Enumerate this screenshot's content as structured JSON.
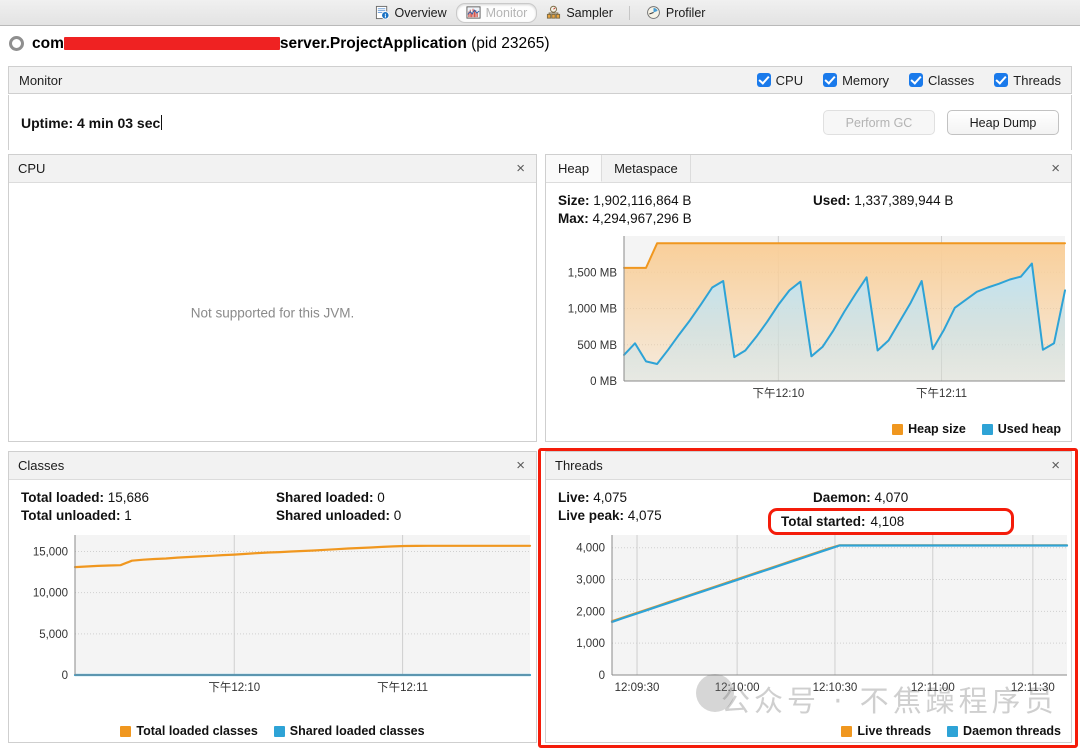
{
  "tabs": [
    {
      "label": "Overview",
      "icon": "overview-icon",
      "selected": false
    },
    {
      "label": "Monitor",
      "icon": "monitor-icon",
      "selected": true
    },
    {
      "label": "Sampler",
      "icon": "sampler-icon",
      "selected": false
    },
    {
      "label": "Profiler",
      "icon": "profiler-icon",
      "selected": false
    }
  ],
  "app": {
    "status_icon": "ring-icon",
    "name_prefix": "com",
    "name_redacted": "█████████████████",
    "name_suffix": "server.ProjectApplication",
    "pid_text": "(pid 23265)"
  },
  "monitor_bar": {
    "title": "Monitor",
    "checkboxes": [
      {
        "label": "CPU",
        "checked": true
      },
      {
        "label": "Memory",
        "checked": true
      },
      {
        "label": "Classes",
        "checked": true
      },
      {
        "label": "Threads",
        "checked": true
      }
    ]
  },
  "uptime": {
    "label": "Uptime: 4 min 03 sec"
  },
  "actions": {
    "perform_gc": "Perform GC",
    "perform_gc_enabled": false,
    "heap_dump": "Heap Dump",
    "heap_dump_enabled": true
  },
  "cpu_panel": {
    "title": "CPU",
    "close": "×",
    "message": "Not supported for this JVM."
  },
  "heap_panel": {
    "tabs": [
      {
        "label": "Heap",
        "selected": true
      },
      {
        "label": "Metaspace",
        "selected": false
      }
    ],
    "close": "×",
    "stats": [
      {
        "label": "Size:",
        "value": "1,902,116,864 B"
      },
      {
        "label": "Used:",
        "value": "1,337,389,944 B"
      },
      {
        "label": "Max:",
        "value": "4,294,967,296 B"
      }
    ],
    "legend": [
      {
        "label": "Heap size",
        "color": "#f0971f"
      },
      {
        "label": "Used heap",
        "color": "#2ea3d6"
      }
    ]
  },
  "classes_panel": {
    "title": "Classes",
    "close": "×",
    "stats": [
      {
        "label": "Total loaded:",
        "value": "15,686"
      },
      {
        "label": "Shared loaded:",
        "value": "0"
      },
      {
        "label": "Total unloaded:",
        "value": "1"
      },
      {
        "label": "Shared unloaded:",
        "value": "0"
      }
    ],
    "legend": [
      {
        "label": "Total loaded classes",
        "color": "#f0971f"
      },
      {
        "label": "Shared loaded classes",
        "color": "#2ea3d6"
      }
    ]
  },
  "threads_panel": {
    "title": "Threads",
    "close": "×",
    "stats": [
      {
        "label": "Live:",
        "value": "4,075"
      },
      {
        "label": "Daemon:",
        "value": "4,070"
      },
      {
        "label": "Live peak:",
        "value": "4,075"
      }
    ],
    "highlighted_stat": {
      "label": "Total started:",
      "value": "4,108"
    },
    "legend": [
      {
        "label": "Live threads",
        "color": "#f0971f"
      },
      {
        "label": "Daemon threads",
        "color": "#2ea3d6"
      }
    ]
  },
  "watermark": {
    "text": "公众号 ·  不焦躁程序员"
  },
  "chart_data": [
    {
      "id": "heap-chart",
      "type": "area",
      "title": "Heap",
      "xlabel": "",
      "ylabel": "",
      "ylim": [
        0,
        2000
      ],
      "yticks": [
        0,
        500,
        1000,
        1500
      ],
      "ytick_labels": [
        "0 MB",
        "500 MB",
        "1,000 MB",
        "1,500 MB"
      ],
      "xtick_labels": [
        "下午12:10",
        "下午12:11"
      ],
      "xtick_positions": [
        0.35,
        0.72
      ],
      "grid": true,
      "legend_position": "bottom",
      "series": [
        {
          "name": "Heap size",
          "color": "#f0971f",
          "fill": "#f9cf9a",
          "values": [
            1560,
            1560,
            1560,
            1900,
            1900,
            1900,
            1900,
            1900,
            1900,
            1900,
            1900,
            1900,
            1900,
            1900,
            1900,
            1900,
            1900,
            1900,
            1900,
            1900,
            1900,
            1900,
            1900,
            1900,
            1900,
            1900,
            1900,
            1900,
            1900,
            1900,
            1900,
            1900,
            1900,
            1900,
            1900,
            1900,
            1900,
            1900,
            1900,
            1900,
            1900
          ]
        },
        {
          "name": "Used heap",
          "color": "#2ea3d6",
          "fill": "#bfe4f5",
          "values": [
            360,
            520,
            270,
            235,
            430,
            640,
            840,
            1060,
            1290,
            1380,
            330,
            420,
            610,
            820,
            1050,
            1250,
            1370,
            340,
            470,
            700,
            960,
            1200,
            1430,
            420,
            560,
            820,
            1080,
            1380,
            440,
            700,
            1010,
            1120,
            1230,
            1290,
            1340,
            1400,
            1440,
            1620,
            430,
            520,
            1250
          ]
        }
      ]
    },
    {
      "id": "classes-chart",
      "type": "line",
      "title": "Classes",
      "ylim": [
        0,
        17000
      ],
      "yticks": [
        0,
        5000,
        10000,
        15000
      ],
      "ytick_labels": [
        "0",
        "5,000",
        "10,000",
        "15,000"
      ],
      "xtick_labels": [
        "下午12:10",
        "下午12:11"
      ],
      "xtick_positions": [
        0.35,
        0.72
      ],
      "grid": true,
      "legend_position": "bottom",
      "series": [
        {
          "name": "Total loaded classes",
          "color": "#f0971f",
          "values": [
            13100,
            13180,
            13250,
            13300,
            13330,
            13880,
            14000,
            14080,
            14150,
            14250,
            14330,
            14400,
            14480,
            14560,
            14620,
            14700,
            14800,
            14870,
            14920,
            15000,
            15060,
            15120,
            15200,
            15280,
            15360,
            15420,
            15480,
            15550,
            15620,
            15660,
            15680,
            15686,
            15686,
            15686,
            15686,
            15686,
            15686,
            15686,
            15686,
            15686,
            15686
          ]
        },
        {
          "name": "Shared loaded classes",
          "color": "#2ea3d6",
          "values": [
            0,
            0,
            0,
            0,
            0,
            0,
            0,
            0,
            0,
            0,
            0,
            0,
            0,
            0,
            0,
            0,
            0,
            0,
            0,
            0,
            0,
            0,
            0,
            0,
            0,
            0,
            0,
            0,
            0,
            0,
            0,
            0,
            0,
            0,
            0,
            0,
            0,
            0,
            0,
            0,
            0
          ]
        }
      ]
    },
    {
      "id": "threads-chart",
      "type": "line",
      "title": "Threads",
      "ylim": [
        0,
        4400
      ],
      "yticks": [
        0,
        1000,
        2000,
        3000,
        4000
      ],
      "ytick_labels": [
        "0",
        "1,000",
        "2,000",
        "3,000",
        "4,000"
      ],
      "xtick_labels": [
        "12:09:30",
        "12:10:00",
        "12:10:30",
        "12:11:00",
        "12:11:30"
      ],
      "xtick_positions": [
        0.055,
        0.275,
        0.49,
        0.705,
        0.925
      ],
      "grid": true,
      "legend_position": "bottom",
      "series": [
        {
          "name": "Live threads",
          "color": "#f0971f",
          "values": [
            1690,
            1810,
            1930,
            2050,
            2170,
            2290,
            2410,
            2530,
            2650,
            2770,
            2890,
            3010,
            3130,
            3250,
            3370,
            3490,
            3610,
            3730,
            3850,
            3970,
            4075,
            4075,
            4075,
            4075,
            4075,
            4075,
            4075,
            4075,
            4075,
            4075,
            4075,
            4075,
            4075,
            4075,
            4075,
            4075,
            4075,
            4075,
            4075,
            4075,
            4075
          ]
        },
        {
          "name": "Daemon threads",
          "color": "#2ea3d6",
          "values": [
            1670,
            1790,
            1910,
            2030,
            2150,
            2270,
            2390,
            2510,
            2630,
            2750,
            2870,
            2990,
            3110,
            3230,
            3350,
            3470,
            3590,
            3710,
            3830,
            3950,
            4070,
            4070,
            4070,
            4070,
            4070,
            4070,
            4070,
            4070,
            4070,
            4070,
            4070,
            4070,
            4070,
            4070,
            4070,
            4070,
            4070,
            4070,
            4070,
            4070,
            4070
          ]
        }
      ]
    }
  ]
}
